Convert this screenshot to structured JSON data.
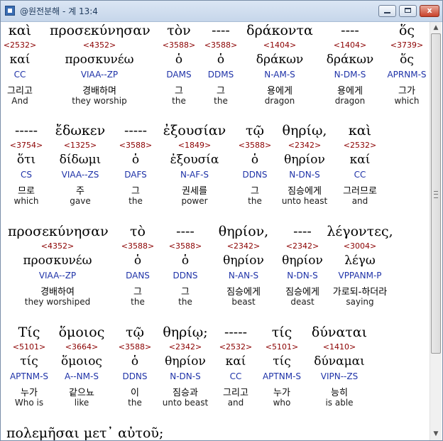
{
  "window": {
    "title": "@원전분해 - 계 13:4",
    "buttons": {
      "minimize": "",
      "maximize": "",
      "close": "x"
    }
  },
  "scrollbar": {
    "up_arrow": "▲",
    "down_arrow": "▼"
  },
  "rows": [
    {
      "words": [
        {
          "greek": "καὶ",
          "number": "<2532>",
          "lemma": "καί",
          "parsing": "CC",
          "korean": "그리고",
          "english": "And"
        },
        {
          "greek": "προσεκύνησαν",
          "number": "<4352>",
          "lemma": "προσκυνέω",
          "parsing": "VIAA--ZP",
          "korean": "경배하며",
          "english": "they worship"
        },
        {
          "greek": "τὸν",
          "number": "<3588>",
          "lemma": "ὁ",
          "parsing": "DAMS",
          "korean": "그",
          "english": "the"
        },
        {
          "greek": "----",
          "number": "<3588>",
          "lemma": "ὁ",
          "parsing": "DDMS",
          "korean": "그",
          "english": "the"
        },
        {
          "greek": "δράκοντα",
          "number": "<1404>",
          "lemma": "δράκων",
          "parsing": "N-AM-S",
          "korean": "용에게",
          "english": "dragon"
        },
        {
          "greek": "----",
          "number": "<1404>",
          "lemma": "δράκων",
          "parsing": "N-DM-S",
          "korean": "용에게",
          "english": "dragon"
        },
        {
          "greek": "ὅς",
          "number": "<3739>",
          "lemma": "ὅς",
          "parsing": "APRNM-S",
          "korean": "그가",
          "english": "which"
        }
      ]
    },
    {
      "words": [
        {
          "greek": "-----",
          "number": "<3754>",
          "lemma": "ὅτι",
          "parsing": "CS",
          "korean": "므로",
          "english": "which"
        },
        {
          "greek": "ἔδωκεν",
          "number": "<1325>",
          "lemma": "δίδωμι",
          "parsing": "VIAA--ZS",
          "korean": "주",
          "english": "gave"
        },
        {
          "greek": "-----",
          "number": "<3588>",
          "lemma": "ὁ",
          "parsing": "DAFS",
          "korean": "그",
          "english": "the"
        },
        {
          "greek": "ἐξουσίαν",
          "number": "<1849>",
          "lemma": "ἐξουσία",
          "parsing": "N-AF-S",
          "korean": "권세를",
          "english": "power"
        },
        {
          "greek": "τῷ",
          "number": "<3588>",
          "lemma": "ὁ",
          "parsing": "DDNS",
          "korean": "그",
          "english": "the"
        },
        {
          "greek": "θηρίῳ,",
          "number": "<2342>",
          "lemma": "θηρίον",
          "parsing": "N-DN-S",
          "korean": "짐승에게",
          "english": "unto heast"
        },
        {
          "greek": "καὶ",
          "number": "<2532>",
          "lemma": "καί",
          "parsing": "CC",
          "korean": "그러므로",
          "english": "and"
        }
      ]
    },
    {
      "words": [
        {
          "greek": "προσεκύνησαν",
          "number": "<4352>",
          "lemma": "προσκυνέω",
          "parsing": "VIAA--ZP",
          "korean": "경배하여",
          "english": "they worshiped"
        },
        {
          "greek": "τὸ",
          "number": "<3588>",
          "lemma": "ὁ",
          "parsing": "DANS",
          "korean": "그",
          "english": "the"
        },
        {
          "greek": "----",
          "number": "<3588>",
          "lemma": "ὁ",
          "parsing": "DDNS",
          "korean": "그",
          "english": "the"
        },
        {
          "greek": "θηρίον,",
          "number": "<2342>",
          "lemma": "θηρίον",
          "parsing": "N-AN-S",
          "korean": "짐승에게",
          "english": "beast"
        },
        {
          "greek": "----",
          "number": "<2342>",
          "lemma": "θηρίον",
          "parsing": "N-DN-S",
          "korean": "짐승에게",
          "english": "deast"
        },
        {
          "greek": "λέγοντες,",
          "number": "<3004>",
          "lemma": "λέγω",
          "parsing": "VPPANM-P",
          "korean": "가로되-하더라",
          "english": "saying"
        }
      ]
    },
    {
      "words": [
        {
          "greek": "Τίς",
          "number": "<5101>",
          "lemma": "τίς",
          "parsing": "APTNM-S",
          "korean": "누가",
          "english": "Who is"
        },
        {
          "greek": "ὅμοιος",
          "number": "<3664>",
          "lemma": "ὅμοιος",
          "parsing": "A--NM-S",
          "korean": "같으뇨",
          "english": "like"
        },
        {
          "greek": "τῷ",
          "number": "<3588>",
          "lemma": "ὁ",
          "parsing": "DDNS",
          "korean": "이",
          "english": "the"
        },
        {
          "greek": "θηρίῳ;",
          "number": "<2342>",
          "lemma": "θηρίον",
          "parsing": "N-DN-S",
          "korean": "짐승과",
          "english": "unto beast"
        },
        {
          "greek": "-----",
          "number": "<2532>",
          "lemma": "καί",
          "parsing": "CC",
          "korean": "그리고",
          "english": "and"
        },
        {
          "greek": "τίς",
          "number": "<5101>",
          "lemma": "τίς",
          "parsing": "APTNM-S",
          "korean": "누가",
          "english": "who"
        },
        {
          "greek": "δύναται",
          "number": "<1410>",
          "lemma": "δύναμαι",
          "parsing": "VIPN--ZS",
          "korean": "능히",
          "english": "is able"
        }
      ]
    }
  ],
  "partial_line": "πολεμῆσαι  μετ᾽  αὐτοῦ;"
}
